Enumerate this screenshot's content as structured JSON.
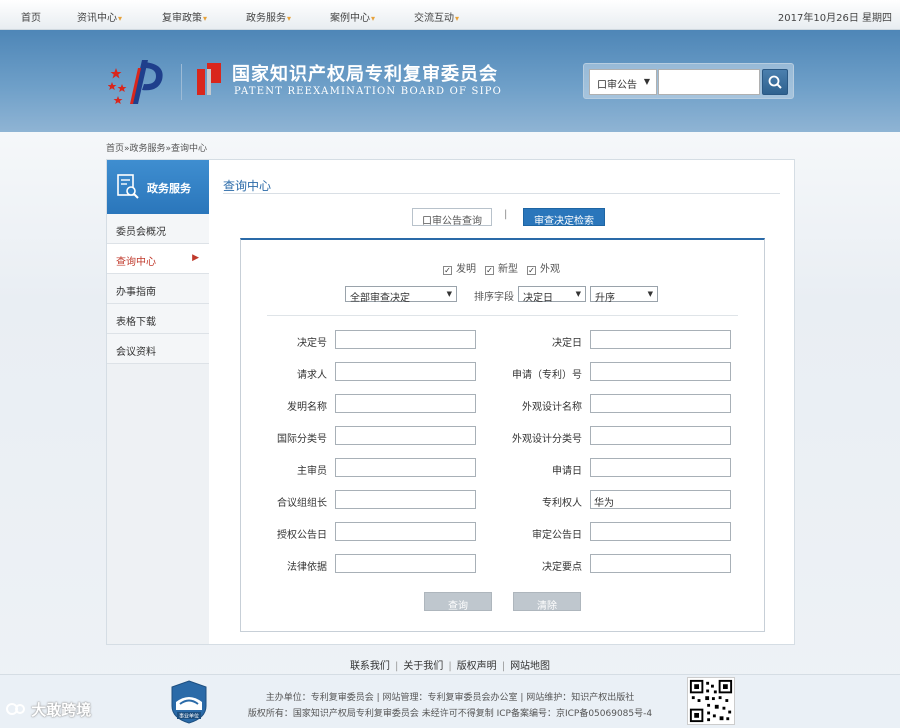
{
  "topnav": {
    "items": [
      {
        "label": "首页",
        "has_menu": false
      },
      {
        "label": "资讯中心",
        "has_menu": true
      },
      {
        "label": "复审政策",
        "has_menu": true
      },
      {
        "label": "政务服务",
        "has_menu": true
      },
      {
        "label": "案例中心",
        "has_menu": true
      },
      {
        "label": "交流互动",
        "has_menu": true
      }
    ],
    "menu_marker": "▾",
    "date": "2017年10月26日  星期四"
  },
  "banner": {
    "org_cn": "国家知识产权局专利复审委员会",
    "org_en": "PATENT REEXAMINATION BOARD OF SIPO",
    "search_select": "口审公告",
    "search_value": ""
  },
  "breadcrumb": "首页»政务服务»查询中心",
  "sidebar": {
    "title": "政务服务",
    "items": [
      {
        "label": "委员会概况"
      },
      {
        "label": "查询中心",
        "active": true
      },
      {
        "label": "办事指南"
      },
      {
        "label": "表格下载"
      },
      {
        "label": "会议资料"
      }
    ],
    "active_marker": "▶"
  },
  "content": {
    "title": "查询中心",
    "tab_1": "口审公告查询",
    "tab_sep": "|",
    "tab_2": "审查决定检索"
  },
  "form": {
    "checks": [
      {
        "label": "发明",
        "checked": true
      },
      {
        "label": "新型",
        "checked": true
      },
      {
        "label": "外观",
        "checked": true
      }
    ],
    "check_mark": "✓",
    "decision_type": "全部审查决定",
    "sort_label": "排序字段",
    "sort_field": "决定日",
    "sort_order": "升序",
    "left_fields": [
      {
        "label": "决定号",
        "value": ""
      },
      {
        "label": "请求人",
        "value": ""
      },
      {
        "label": "发明名称",
        "value": ""
      },
      {
        "label": "国际分类号",
        "value": ""
      },
      {
        "label": "主审员",
        "value": ""
      },
      {
        "label": "合议组组长",
        "value": ""
      },
      {
        "label": "授权公告日",
        "value": ""
      },
      {
        "label": "法律依据",
        "value": ""
      }
    ],
    "right_fields": [
      {
        "label": "决定日",
        "value": ""
      },
      {
        "label": "申请（专利）号",
        "value": ""
      },
      {
        "label": "外观设计名称",
        "value": ""
      },
      {
        "label": "外观设计分类号",
        "value": ""
      },
      {
        "label": "申请日",
        "value": ""
      },
      {
        "label": "专利权人",
        "value": "华为"
      },
      {
        "label": "审定公告日",
        "value": ""
      },
      {
        "label": "决定要点",
        "value": ""
      }
    ],
    "query_button": "查询",
    "clear_button": "清除"
  },
  "footer": {
    "links": [
      "联系我们",
      "关于我们",
      "版权声明",
      "网站地图"
    ],
    "link_sep": "|",
    "line1": "主办单位：专利复审委员会 | 网站管理：专利复审委员会办公室 | 网站维护：知识产权出版社",
    "line2": "版权所有：国家知识产权局专利复审委员会 未经许可不得复制 ICP备案编号：京ICP备05069085号-4",
    "badge_text": "事业单位",
    "watermark": "大敢跨境"
  },
  "colors": {
    "accent": "#2a76bb",
    "active_red": "#c0392b",
    "banner": "#6e9fc8"
  }
}
